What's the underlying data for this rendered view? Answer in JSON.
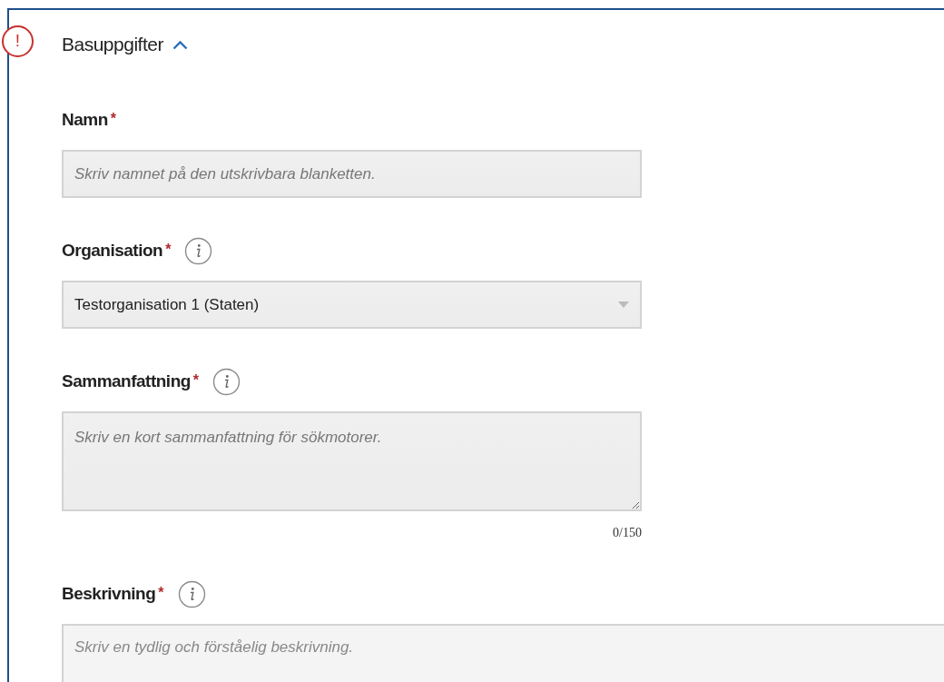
{
  "section": {
    "title": "Basuppgifter",
    "expanded": true,
    "error_mark": "!"
  },
  "fields": [
    {
      "kind": "input",
      "label": "Namn",
      "required_mark": "*",
      "info": false,
      "placeholder": "Skriv namnet på den utskrivbara blanketten."
    },
    {
      "kind": "select",
      "label": "Organisation",
      "required_mark": "*",
      "info": true,
      "value": "Testorganisation 1 (Staten)"
    },
    {
      "kind": "textarea",
      "label": "Sammanfattning",
      "required_mark": "*",
      "info": true,
      "placeholder": "Skriv en kort sammanfattning för sökmotorer.",
      "counter": "0/150"
    },
    {
      "kind": "wide",
      "label": "Beskrivning",
      "required_mark": "*",
      "info": true,
      "placeholder": "Skriv en tydlig och förståelig beskrivning."
    }
  ]
}
